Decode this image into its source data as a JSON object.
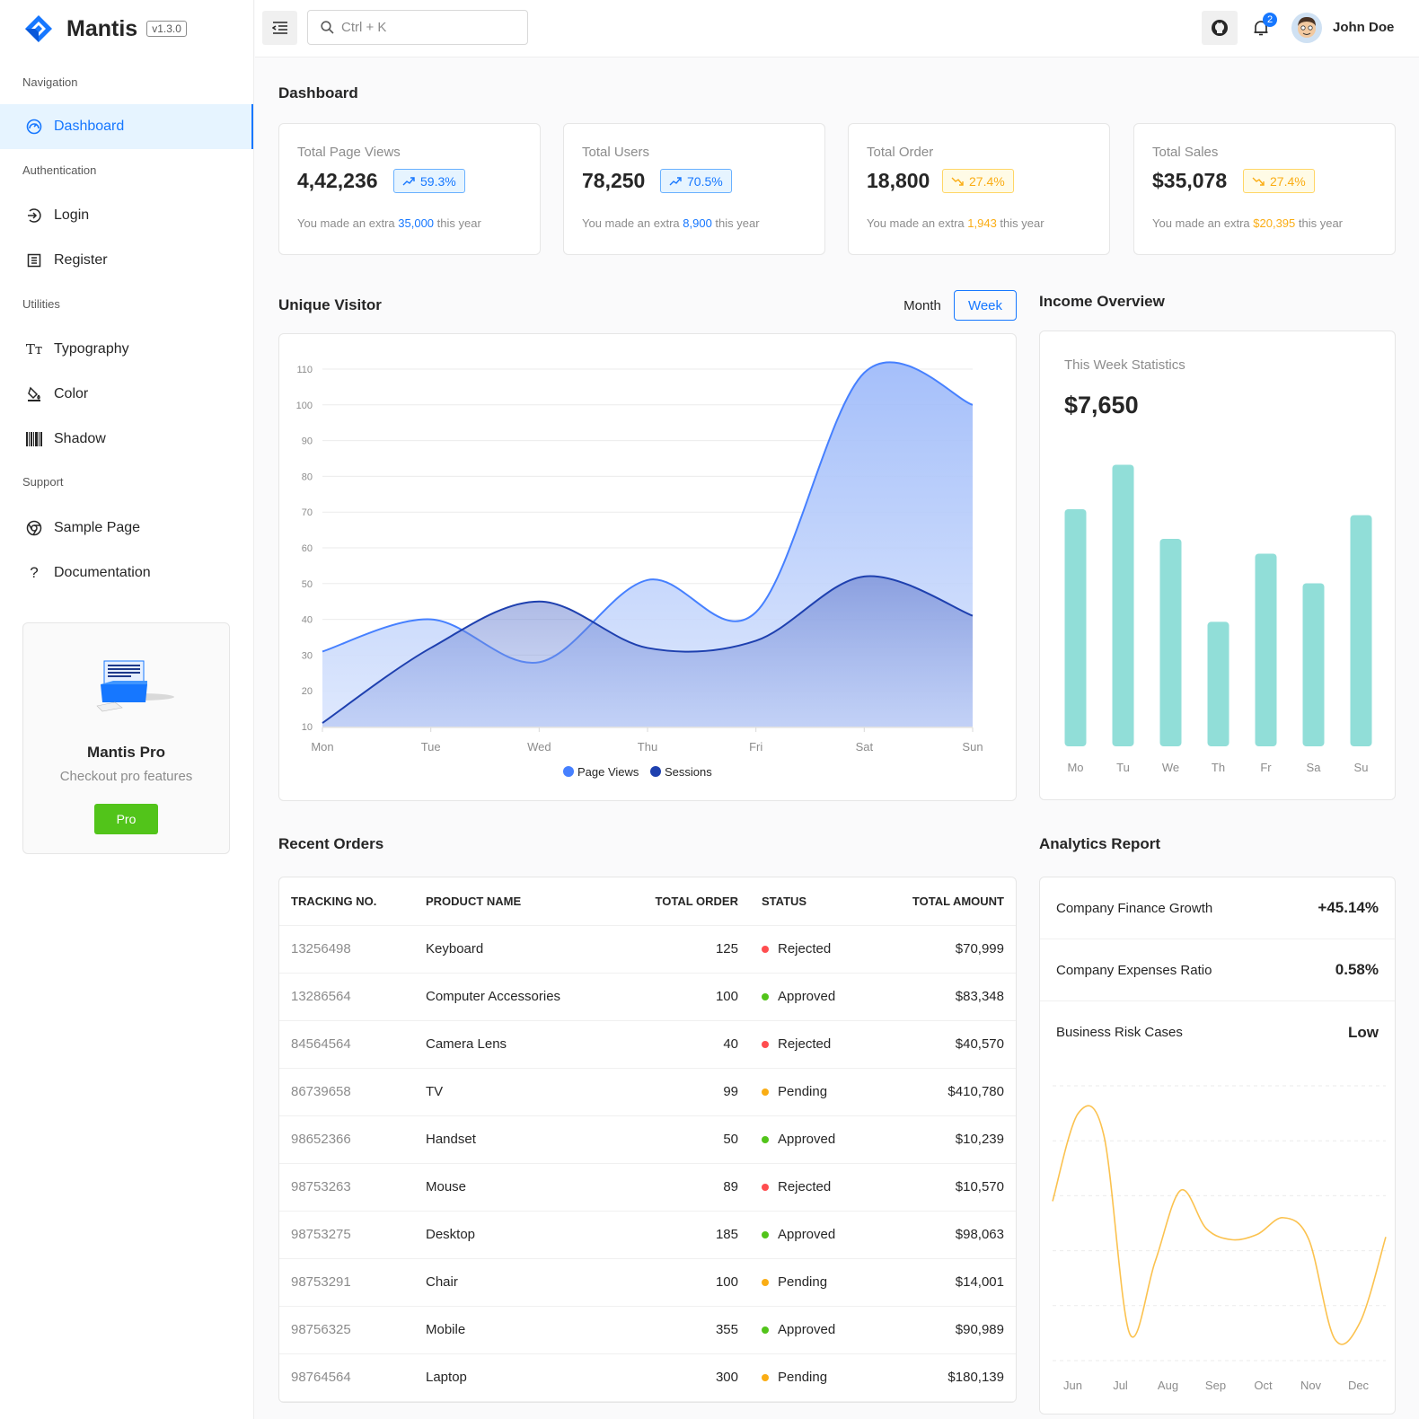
{
  "app": {
    "name": "Mantis",
    "version": "v1.3.0"
  },
  "sidebar": {
    "groups": [
      {
        "title": "Navigation",
        "items": [
          {
            "label": "Dashboard",
            "icon": "dashboard-icon",
            "active": true
          }
        ]
      },
      {
        "title": "Authentication",
        "items": [
          {
            "label": "Login",
            "icon": "login-icon"
          },
          {
            "label": "Register",
            "icon": "register-icon"
          }
        ]
      },
      {
        "title": "Utilities",
        "items": [
          {
            "label": "Typography",
            "icon": "typography-icon"
          },
          {
            "label": "Color",
            "icon": "color-icon"
          },
          {
            "label": "Shadow",
            "icon": "shadow-icon"
          }
        ]
      },
      {
        "title": "Support",
        "items": [
          {
            "label": "Sample Page",
            "icon": "chrome-icon"
          },
          {
            "label": "Documentation",
            "icon": "question-icon"
          }
        ]
      }
    ],
    "pro": {
      "title": "Mantis Pro",
      "subtitle": "Checkout pro features",
      "button": "Pro"
    }
  },
  "header": {
    "search_placeholder": "Ctrl + K",
    "notifications": "2",
    "user": "John Doe"
  },
  "page_title": "Dashboard",
  "stats": [
    {
      "label": "Total Page Views",
      "value": "4,42,236",
      "change": "59.3%",
      "trend": "up",
      "color": "blue",
      "note_pre": "You made an extra ",
      "note_hl": "35,000",
      "note_post": " this year"
    },
    {
      "label": "Total Users",
      "value": "78,250",
      "change": "70.5%",
      "trend": "up",
      "color": "blue",
      "note_pre": "You made an extra ",
      "note_hl": "8,900",
      "note_post": " this year"
    },
    {
      "label": "Total Order",
      "value": "18,800",
      "change": "27.4%",
      "trend": "down",
      "color": "gold",
      "note_pre": "You made an extra ",
      "note_hl": "1,943",
      "note_post": " this year"
    },
    {
      "label": "Total Sales",
      "value": "$35,078",
      "change": "27.4%",
      "trend": "down",
      "color": "gold",
      "note_pre": "You made an extra ",
      "note_hl": "$20,395",
      "note_post": " this year"
    }
  ],
  "visitor": {
    "title": "Unique Visitor",
    "toggle_month": "Month",
    "toggle_week": "Week",
    "active": "Week"
  },
  "income": {
    "title": "Income Overview",
    "subtitle": "This Week Statistics",
    "value": "$7,650"
  },
  "orders": {
    "title": "Recent Orders",
    "headers": [
      "TRACKING NO.",
      "PRODUCT NAME",
      "TOTAL ORDER",
      "STATUS",
      "TOTAL AMOUNT"
    ],
    "rows": [
      {
        "tracking": "13256498",
        "product": "Keyboard",
        "qty": "125",
        "status": "Rejected",
        "amount": "$70,999"
      },
      {
        "tracking": "13286564",
        "product": "Computer Accessories",
        "qty": "100",
        "status": "Approved",
        "amount": "$83,348"
      },
      {
        "tracking": "84564564",
        "product": "Camera Lens",
        "qty": "40",
        "status": "Rejected",
        "amount": "$40,570"
      },
      {
        "tracking": "86739658",
        "product": "TV",
        "qty": "99",
        "status": "Pending",
        "amount": "$410,780"
      },
      {
        "tracking": "98652366",
        "product": "Handset",
        "qty": "50",
        "status": "Approved",
        "amount": "$10,239"
      },
      {
        "tracking": "98753263",
        "product": "Mouse",
        "qty": "89",
        "status": "Rejected",
        "amount": "$10,570"
      },
      {
        "tracking": "98753275",
        "product": "Desktop",
        "qty": "185",
        "status": "Approved",
        "amount": "$98,063"
      },
      {
        "tracking": "98753291",
        "product": "Chair",
        "qty": "100",
        "status": "Pending",
        "amount": "$14,001"
      },
      {
        "tracking": "98756325",
        "product": "Mobile",
        "qty": "355",
        "status": "Approved",
        "amount": "$90,989"
      },
      {
        "tracking": "98764564",
        "product": "Laptop",
        "qty": "300",
        "status": "Pending",
        "amount": "$180,139"
      }
    ],
    "status_colors": {
      "Rejected": "#ff4d4f",
      "Approved": "#52c41a",
      "Pending": "#faad14"
    }
  },
  "analytics": {
    "title": "Analytics Report",
    "rows": [
      {
        "label": "Company Finance Growth",
        "value": "+45.14%"
      },
      {
        "label": "Company Expenses Ratio",
        "value": "0.58%"
      },
      {
        "label": "Business Risk Cases",
        "value": "Low"
      }
    ]
  },
  "colors": {
    "primary": "#1677ff",
    "page_views": "#4680ff",
    "sessions": "#1e40af",
    "income_bar": "#13c2c2",
    "analytics_line": "#faad14"
  },
  "chart_data": [
    {
      "type": "area",
      "x": [
        "Mon",
        "Tue",
        "Wed",
        "Thu",
        "Fri",
        "Sat",
        "Sun"
      ],
      "ylim": [
        10,
        110
      ],
      "yticks": [
        10,
        20,
        30,
        40,
        50,
        60,
        70,
        80,
        90,
        100,
        110
      ],
      "series": [
        {
          "name": "Page Views",
          "values": [
            31,
            40,
            28,
            51,
            42,
            109,
            100
          ]
        },
        {
          "name": "Sessions",
          "values": [
            11,
            32,
            45,
            32,
            34,
            52,
            41
          ]
        }
      ],
      "legend": "bottom-center",
      "grid": true
    },
    {
      "type": "bar",
      "categories": [
        "Mo",
        "Tu",
        "We",
        "Th",
        "Fr",
        "Sa",
        "Su"
      ],
      "values": [
        80,
        95,
        70,
        42,
        65,
        55,
        78
      ],
      "ylim": [
        0,
        100
      ],
      "grid": false
    },
    {
      "type": "line",
      "x": [
        "Jun",
        "Jul",
        "Aug",
        "Sep",
        "Oct",
        "Nov",
        "Dec"
      ],
      "values": [
        58,
        88,
        40,
        48,
        44,
        5,
        45
      ],
      "curve_points": [
        58,
        90,
        82,
        10,
        36,
        62,
        48,
        44,
        46,
        52,
        44,
        8,
        14,
        45
      ],
      "grid": true
    }
  ]
}
